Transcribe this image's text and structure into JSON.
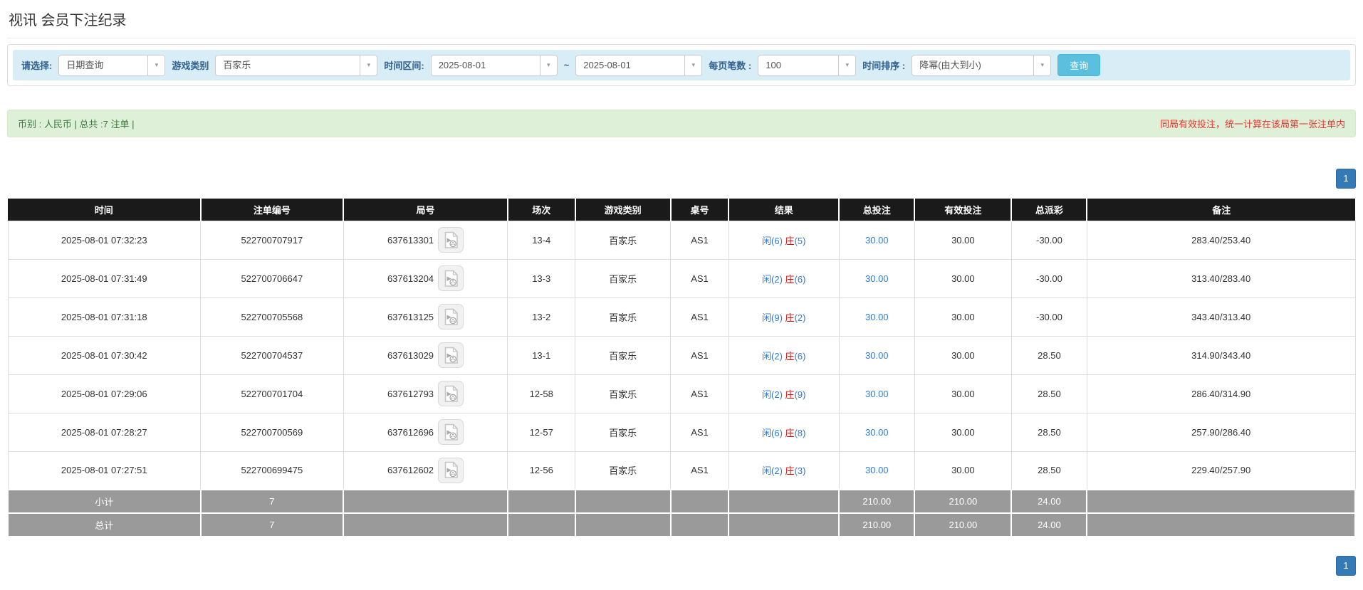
{
  "page": {
    "title": "视讯 会员下注纪录"
  },
  "icons": {
    "caret": "▾",
    "video_replay": "video-file-icon"
  },
  "filters": {
    "select_label": "请选择:",
    "select_value": "日期查询",
    "game_type_label": "游戏类别",
    "game_type_value": "百家乐",
    "time_range_label": "时间区间:",
    "time_from": "2025-08-01",
    "tilde": "~",
    "time_to": "2025-08-01",
    "per_page_label": "每页笔数 :",
    "per_page_value": "100",
    "sort_label": "时间排序 :",
    "sort_value": "降幂(由大到小)",
    "search_button": "查询"
  },
  "summary_bar": {
    "left_text": "币别 : 人民币 | 总共 :7 注单 |",
    "right_text": "同局有效投注，统一计算在该局第一张注单内"
  },
  "pagination": {
    "page": "1"
  },
  "table": {
    "headers": [
      "时间",
      "注单编号",
      "局号",
      "场次",
      "游戏类别",
      "桌号",
      "结果",
      "总投注",
      "有效投注",
      "总派彩",
      "备注"
    ],
    "rows": [
      {
        "time": "2025-08-01 07:32:23",
        "bet_id": "522700707917",
        "round_id": "637613301",
        "session": "13-4",
        "game": "百家乐",
        "table_no": "AS1",
        "result_player": "闲",
        "result_player_num": "(6)",
        "result_banker": "庄",
        "result_banker_num": "(5)",
        "total_bet": "30.00",
        "valid_bet": "30.00",
        "payout": "-30.00",
        "note": "283.40/253.40"
      },
      {
        "time": "2025-08-01 07:31:49",
        "bet_id": "522700706647",
        "round_id": "637613204",
        "session": "13-3",
        "game": "百家乐",
        "table_no": "AS1",
        "result_player": "闲",
        "result_player_num": "(2)",
        "result_banker": "庄",
        "result_banker_num": "(6)",
        "total_bet": "30.00",
        "valid_bet": "30.00",
        "payout": "-30.00",
        "note": "313.40/283.40"
      },
      {
        "time": "2025-08-01 07:31:18",
        "bet_id": "522700705568",
        "round_id": "637613125",
        "session": "13-2",
        "game": "百家乐",
        "table_no": "AS1",
        "result_player": "闲",
        "result_player_num": "(9)",
        "result_banker": "庄",
        "result_banker_num": "(2)",
        "total_bet": "30.00",
        "valid_bet": "30.00",
        "payout": "-30.00",
        "note": "343.40/313.40"
      },
      {
        "time": "2025-08-01 07:30:42",
        "bet_id": "522700704537",
        "round_id": "637613029",
        "session": "13-1",
        "game": "百家乐",
        "table_no": "AS1",
        "result_player": "闲",
        "result_player_num": "(2)",
        "result_banker": "庄",
        "result_banker_num": "(6)",
        "total_bet": "30.00",
        "valid_bet": "30.00",
        "payout": "28.50",
        "note": "314.90/343.40"
      },
      {
        "time": "2025-08-01 07:29:06",
        "bet_id": "522700701704",
        "round_id": "637612793",
        "session": "12-58",
        "game": "百家乐",
        "table_no": "AS1",
        "result_player": "闲",
        "result_player_num": "(2)",
        "result_banker": "庄",
        "result_banker_num": "(9)",
        "total_bet": "30.00",
        "valid_bet": "30.00",
        "payout": "28.50",
        "note": "286.40/314.90"
      },
      {
        "time": "2025-08-01 07:28:27",
        "bet_id": "522700700569",
        "round_id": "637612696",
        "session": "12-57",
        "game": "百家乐",
        "table_no": "AS1",
        "result_player": "闲",
        "result_player_num": "(6)",
        "result_banker": "庄",
        "result_banker_num": "(8)",
        "total_bet": "30.00",
        "valid_bet": "30.00",
        "payout": "28.50",
        "note": "257.90/286.40"
      },
      {
        "time": "2025-08-01 07:27:51",
        "bet_id": "522700699475",
        "round_id": "637612602",
        "session": "12-56",
        "game": "百家乐",
        "table_no": "AS1",
        "result_player": "闲",
        "result_player_num": "(2)",
        "result_banker": "庄",
        "result_banker_num": "(3)",
        "total_bet": "30.00",
        "valid_bet": "30.00",
        "payout": "28.50",
        "note": "229.40/257.90"
      }
    ],
    "subtotal": {
      "label": "小计",
      "count": "7",
      "total_bet": "210.00",
      "valid_bet": "210.00",
      "payout": "24.00"
    },
    "total": {
      "label": "总计",
      "count": "7",
      "total_bet": "210.00",
      "valid_bet": "210.00",
      "payout": "24.00"
    }
  }
}
